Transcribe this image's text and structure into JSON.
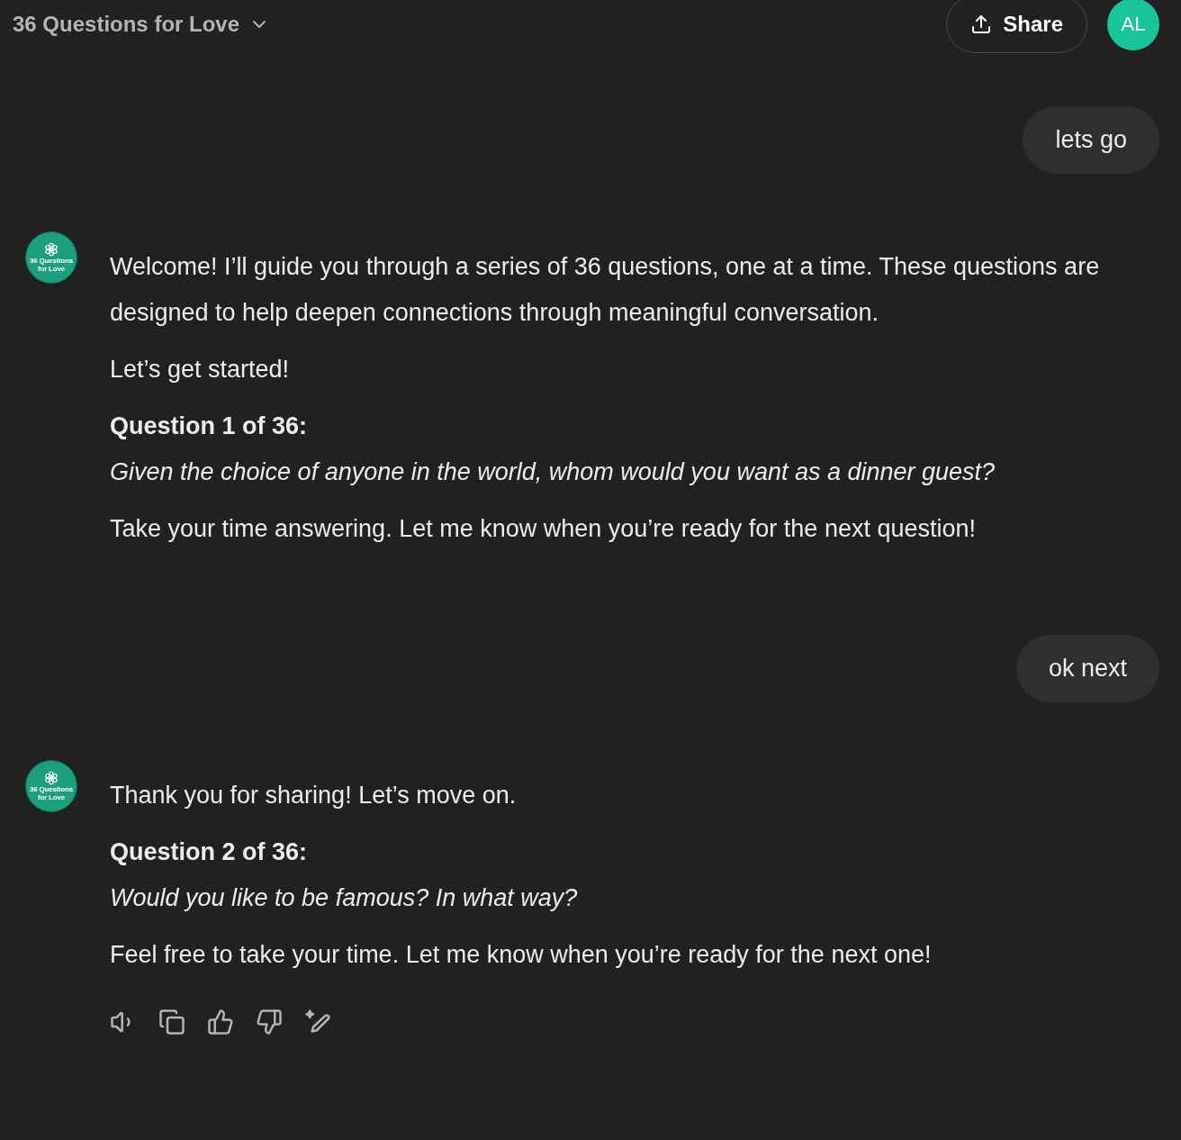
{
  "header": {
    "title": "36 Questions for Love",
    "share_label": "Share",
    "user_initials": "AL"
  },
  "messages": [
    {
      "kind": "user",
      "text": "lets go"
    },
    {
      "kind": "assistant",
      "avatar_label": "36 Questions for Love",
      "paragraphs": [
        {
          "kind": "text",
          "text": "Welcome! I’ll guide you through a series of 36 questions, one at a time. These questions are designed to help deepen connections through meaningful conversation."
        },
        {
          "kind": "text",
          "text": "Let’s get started!"
        },
        {
          "kind": "heading",
          "text": "Question 1 of 36:"
        },
        {
          "kind": "question",
          "text": "Given the choice of anyone in the world, whom would you want as a dinner guest?"
        },
        {
          "kind": "text",
          "text": "Take your time answering. Let me know when you’re ready for the next question!"
        }
      ],
      "actions": false
    },
    {
      "kind": "user",
      "text": "ok next"
    },
    {
      "kind": "assistant",
      "avatar_label": "36 Questions for Love",
      "paragraphs": [
        {
          "kind": "text",
          "text": "Thank you for sharing! Let’s move on."
        },
        {
          "kind": "heading",
          "text": "Question 2 of 36:"
        },
        {
          "kind": "question",
          "text": "Would you like to be famous? In what way?"
        },
        {
          "kind": "text",
          "text": "Feel free to take your time. Let me know when you’re ready for the next one!"
        }
      ],
      "actions": true
    }
  ]
}
